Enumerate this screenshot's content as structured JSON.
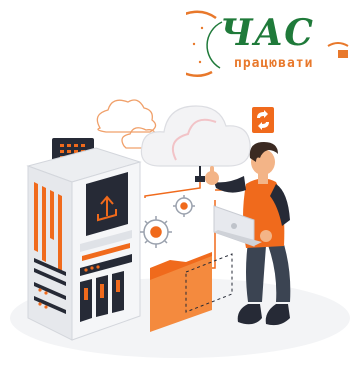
{
  "logo": {
    "main_text": "ЧАС",
    "sub_text": "працювати"
  },
  "illustration": {
    "icons": [
      "cloud-icon",
      "upload-icon",
      "gear-icon",
      "folder-icon",
      "laptop-icon",
      "sync-icon"
    ]
  },
  "colors": {
    "accent_orange": "#f06a1c",
    "logo_green": "#1f7a3a",
    "logo_orange": "#e8782b",
    "dark_navy": "#262a36",
    "light_grey": "#eceef1"
  }
}
